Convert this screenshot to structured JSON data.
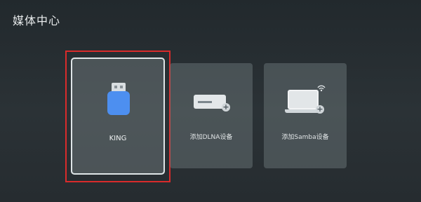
{
  "header": {
    "title": "媒体中心"
  },
  "cards": [
    {
      "id": "king",
      "label": "KING",
      "icon": "usb-drive-icon",
      "focused": true
    },
    {
      "id": "dlna",
      "label": "添加DLNA设备",
      "icon": "dlna-device-icon"
    },
    {
      "id": "samba",
      "label": "添加Samba设备",
      "icon": "laptop-wifi-icon"
    }
  ],
  "colors": {
    "focus_frame": "#d92b2b",
    "usb_body": "#4d8ff0",
    "background": "#2b3236"
  }
}
